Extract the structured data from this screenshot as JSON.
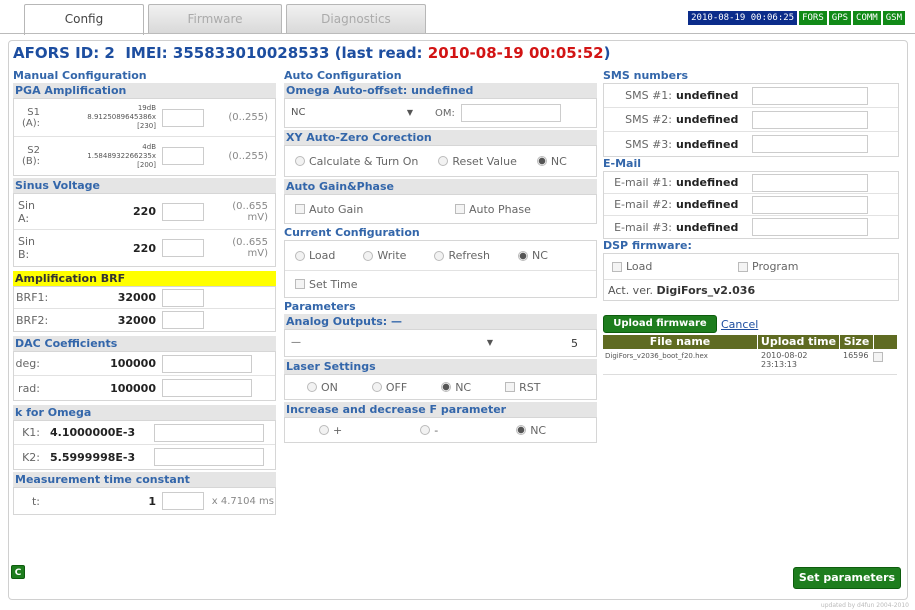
{
  "tabs": [
    "Config",
    "Firmware",
    "Diagnostics"
  ],
  "status": {
    "datetime": "2010-08-19 00:06:25",
    "badges": [
      "FORS",
      "GPS",
      "COMM",
      "GSM"
    ]
  },
  "header": {
    "id_label": "AFORS ID: 2",
    "imei_label": "IMEI: 355833010028533",
    "last_read_prefix": "(last read: ",
    "last_read_time": "2010-08-19 00:05:52",
    "last_read_suffix": ")"
  },
  "manual": {
    "title": "Manual Configuration",
    "pga": {
      "title": "PGA Amplification",
      "s1": {
        "label": "S1 (A):",
        "db": "19dB",
        "gain": "8.9125089645386x",
        "raw": "[230]",
        "range": "(0..255)"
      },
      "s2": {
        "label": "S2 (B):",
        "db": "4dB",
        "gain": "1.5848932266235x",
        "raw": "[200]",
        "range": "(0..255)"
      }
    },
    "sinus": {
      "title": "Sinus Voltage",
      "a": {
        "label": "Sin A:",
        "value": "220",
        "range1": "(0..655",
        "range2": "mV)"
      },
      "b": {
        "label": "Sin B:",
        "value": "220",
        "range1": "(0..655",
        "range2": "mV)"
      }
    },
    "brf": {
      "title": "Amplification BRF",
      "b1": {
        "label": "BRF1:",
        "value": "32000"
      },
      "b2": {
        "label": "BRF2:",
        "value": "32000"
      }
    },
    "dac": {
      "title": "DAC Coefficients",
      "deg": {
        "label": "deg:",
        "value": "100000"
      },
      "rad": {
        "label": "rad:",
        "value": "100000"
      }
    },
    "k": {
      "title": "k for Omega",
      "k1": {
        "label": "K1:",
        "value": "4.1000000E-3"
      },
      "k2": {
        "label": "K2:",
        "value": "5.5999998E-3"
      }
    },
    "mtc": {
      "title": "Measurement time constant",
      "t": {
        "label": "t:",
        "value": "1",
        "unit": "x 4.7104 ms"
      }
    }
  },
  "auto": {
    "title": "Auto Configuration",
    "omega": {
      "title": "Omega Auto-offset: undefined",
      "select": "NC",
      "om_label": "OM:"
    },
    "xy": {
      "title": "XY Auto-Zero Corection",
      "o1": "Calculate & Turn On",
      "o2": "Reset Value",
      "o3": "NC"
    },
    "gain": {
      "title": "Auto Gain&Phase",
      "o1": "Auto Gain",
      "o2": "Auto Phase"
    },
    "current": {
      "title": "Current Configuration",
      "o1": "Load",
      "o2": "Write",
      "o3": "Refresh",
      "o4": "NC",
      "o5": "Set Time"
    }
  },
  "params": {
    "title": "Parameters",
    "analog": {
      "title": "Analog Outputs: —",
      "select": "—",
      "count": "5"
    },
    "laser": {
      "title": "Laser Settings",
      "o1": "ON",
      "o2": "OFF",
      "o3": "NC",
      "o4": "RST"
    },
    "incdec": {
      "title": "Increase and decrease F parameter",
      "o1": "+",
      "o2": "-",
      "o3": "NC"
    }
  },
  "sms": {
    "title": "SMS numbers",
    "items": [
      {
        "label": "SMS #1:",
        "value": "undefined"
      },
      {
        "label": "SMS #2:",
        "value": "undefined"
      },
      {
        "label": "SMS #3:",
        "value": "undefined"
      }
    ]
  },
  "email": {
    "title": "E-Mail",
    "items": [
      {
        "label": "E-mail #1:",
        "value": "undefined"
      },
      {
        "label": "E-mail #2:",
        "value": "undefined"
      },
      {
        "label": "E-mail #3:",
        "value": "undefined"
      }
    ]
  },
  "dsp": {
    "title": "DSP firmware:",
    "load": "Load",
    "program": "Program",
    "act_label": "Act. ver.",
    "act_value": "DigiFors_v2.036"
  },
  "upload": {
    "button": "Upload firmware",
    "cancel": "Cancel",
    "columns": [
      "File name",
      "Upload time",
      "Size"
    ],
    "file": "DigiFors_v2036_boot_f20.hex",
    "time": "2010-08-02 23:13:13",
    "size": "16596"
  },
  "set_button": "Set parameters",
  "c_label": "C",
  "footer": "updated by d4fun 2004-2010"
}
